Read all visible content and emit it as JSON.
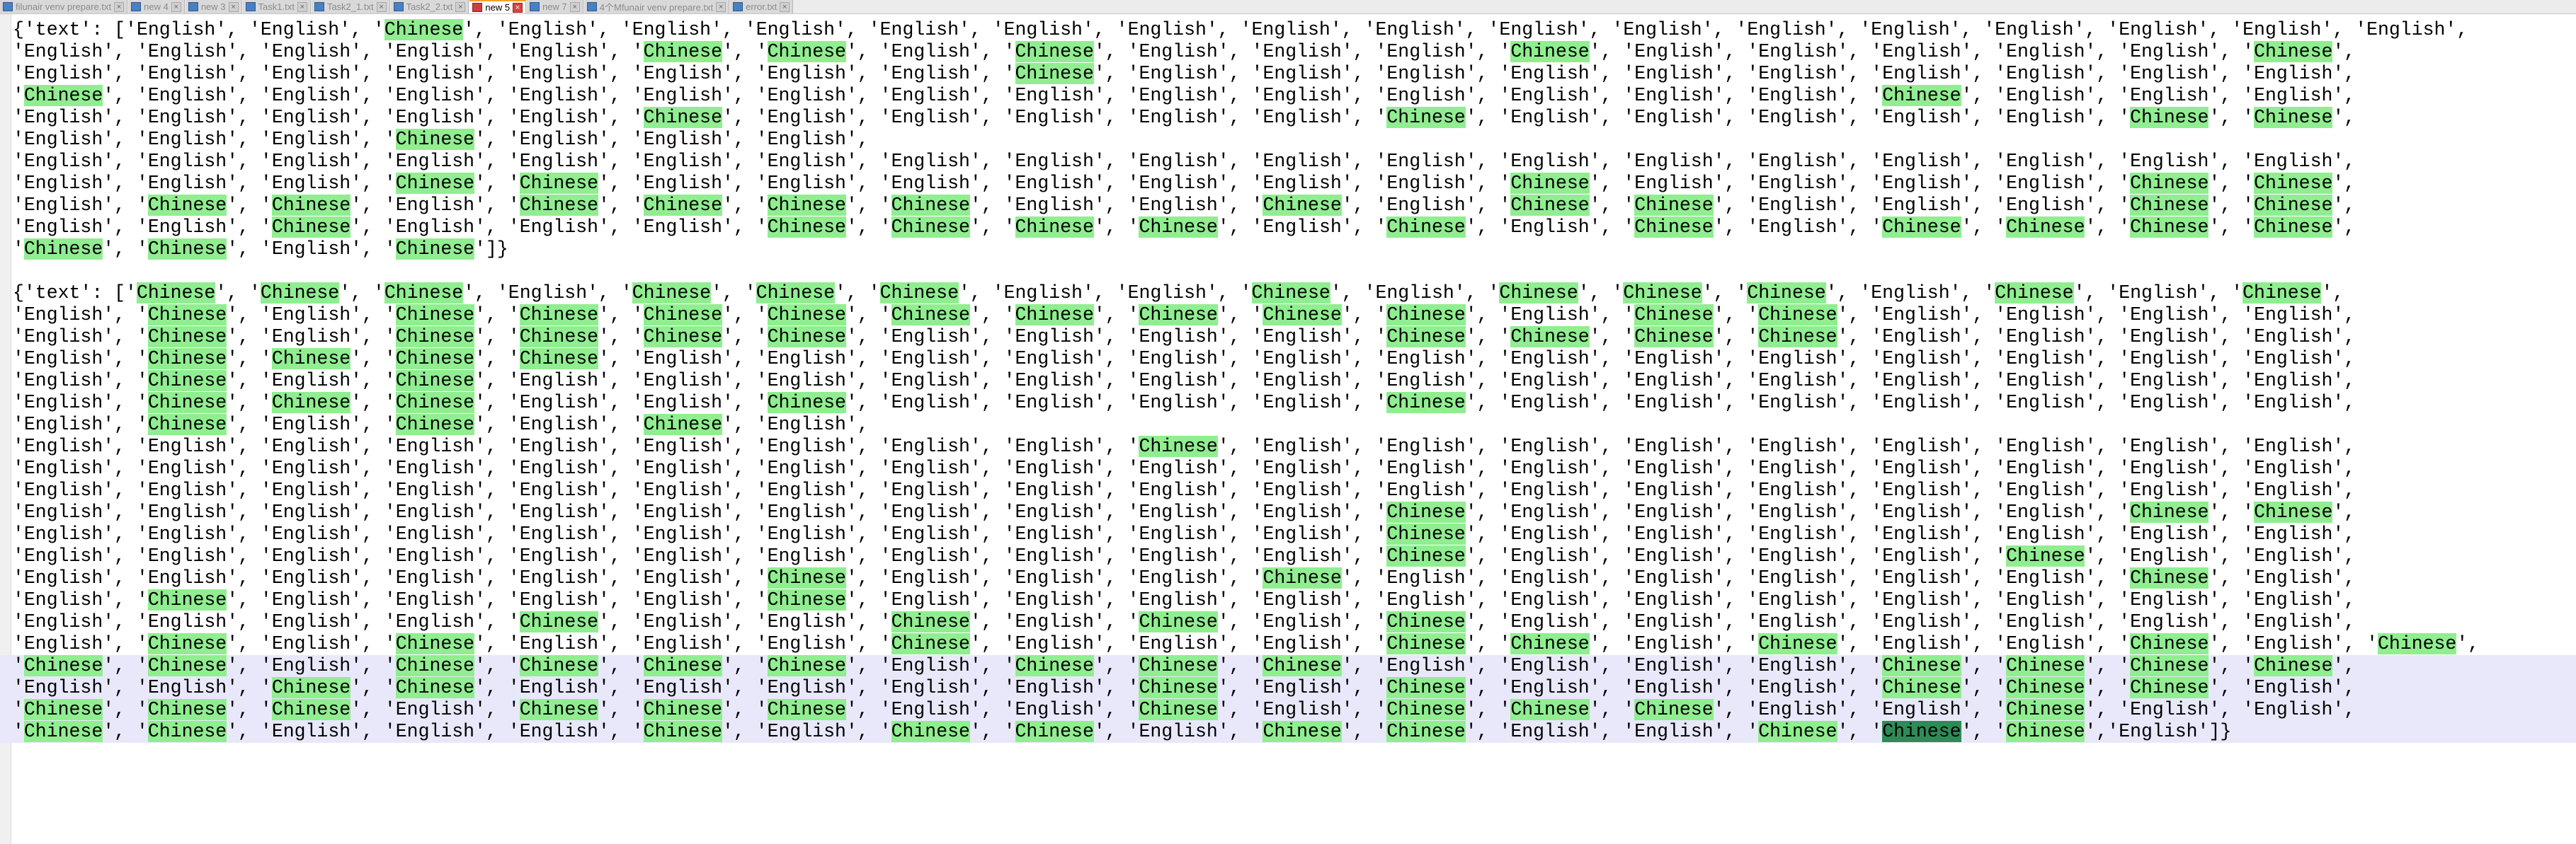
{
  "tabs": [
    {
      "label": "filunair venv prepare.txt",
      "active": false
    },
    {
      "label": "new 4",
      "active": false
    },
    {
      "label": "new 3",
      "active": false
    },
    {
      "label": "Task1.txt",
      "active": false
    },
    {
      "label": "Task2_1.txt",
      "active": false
    },
    {
      "label": "Task2_2.txt",
      "active": false
    },
    {
      "label": "new 5",
      "active": true
    },
    {
      "label": "new 7",
      "active": false
    },
    {
      "label": "4个Mfunair venv prepare.txt",
      "active": false
    },
    {
      "label": "error.txt",
      "active": false
    }
  ],
  "editor": {
    "block1": {
      "prefix": "{'text': [",
      "suffix": "]}",
      "lines": [
        "EECEEEEEEEEEEEEEEEE",
        "EEEEECCECEEECEEEEEC",
        "EEEEEEEECEEEEEEEEEE",
        "CEEEEEEEEEEEEEECEEE",
        "EEEEECEEEEECEEEEECC",
        "EEECEEE",
        "EEEEEEEEEEEEEEEEEEE",
        "EEECCEEEEEEECEEEECC",
        "ECCECCCCEECECCEEECC",
        "EECEEECCCCECECECCCC",
        "CCEC"
      ]
    },
    "block2": {
      "prefix": "{'text': [",
      "suffix": "]}",
      "lines": [
        "CCCECCCEECECCCECEC",
        "ECECCCCCCCCCECCEEEE",
        "ECECCCCEEEECCCCEEEE",
        "ECCCCEEEEEEEEEEEEEE",
        "ECECEEEEEEEEEEEEEEE",
        "ECCCEECEEEECEEEEEEE",
        "ECECECE",
        "EEEEEEEEECEEEEEEEEE",
        "EEEEEEEEEEEEEEEEEEE",
        "EEEEEEEEEEEEEEEEEEE",
        "EEEEEEEEEEECEEEEECC",
        "EEEEEEEEEEECEEEEEEE",
        "EEEEEEEEEEECEEEECEE",
        "EEEEEECEEECEEEEEECE",
        "ECEEEECEEEEEEEEEEEE",
        "EEEECEECECECEEEEEEE",
        "ECECEEECEEECCECEECEC",
        "CCECCCCECCCEEEECCCC",
        "EECCEEEEECECEEECCCE",
        "CCCECCCEECECCCEECEE",
        "CCEEECECCECCEECCC"
      ],
      "last_word": "English"
    },
    "words": {
      "E": "English",
      "C": "Chinese"
    }
  },
  "colors": {
    "highlight": "#90ee90",
    "current_match": "#2e8b57",
    "selection": "#e8e8fa"
  }
}
